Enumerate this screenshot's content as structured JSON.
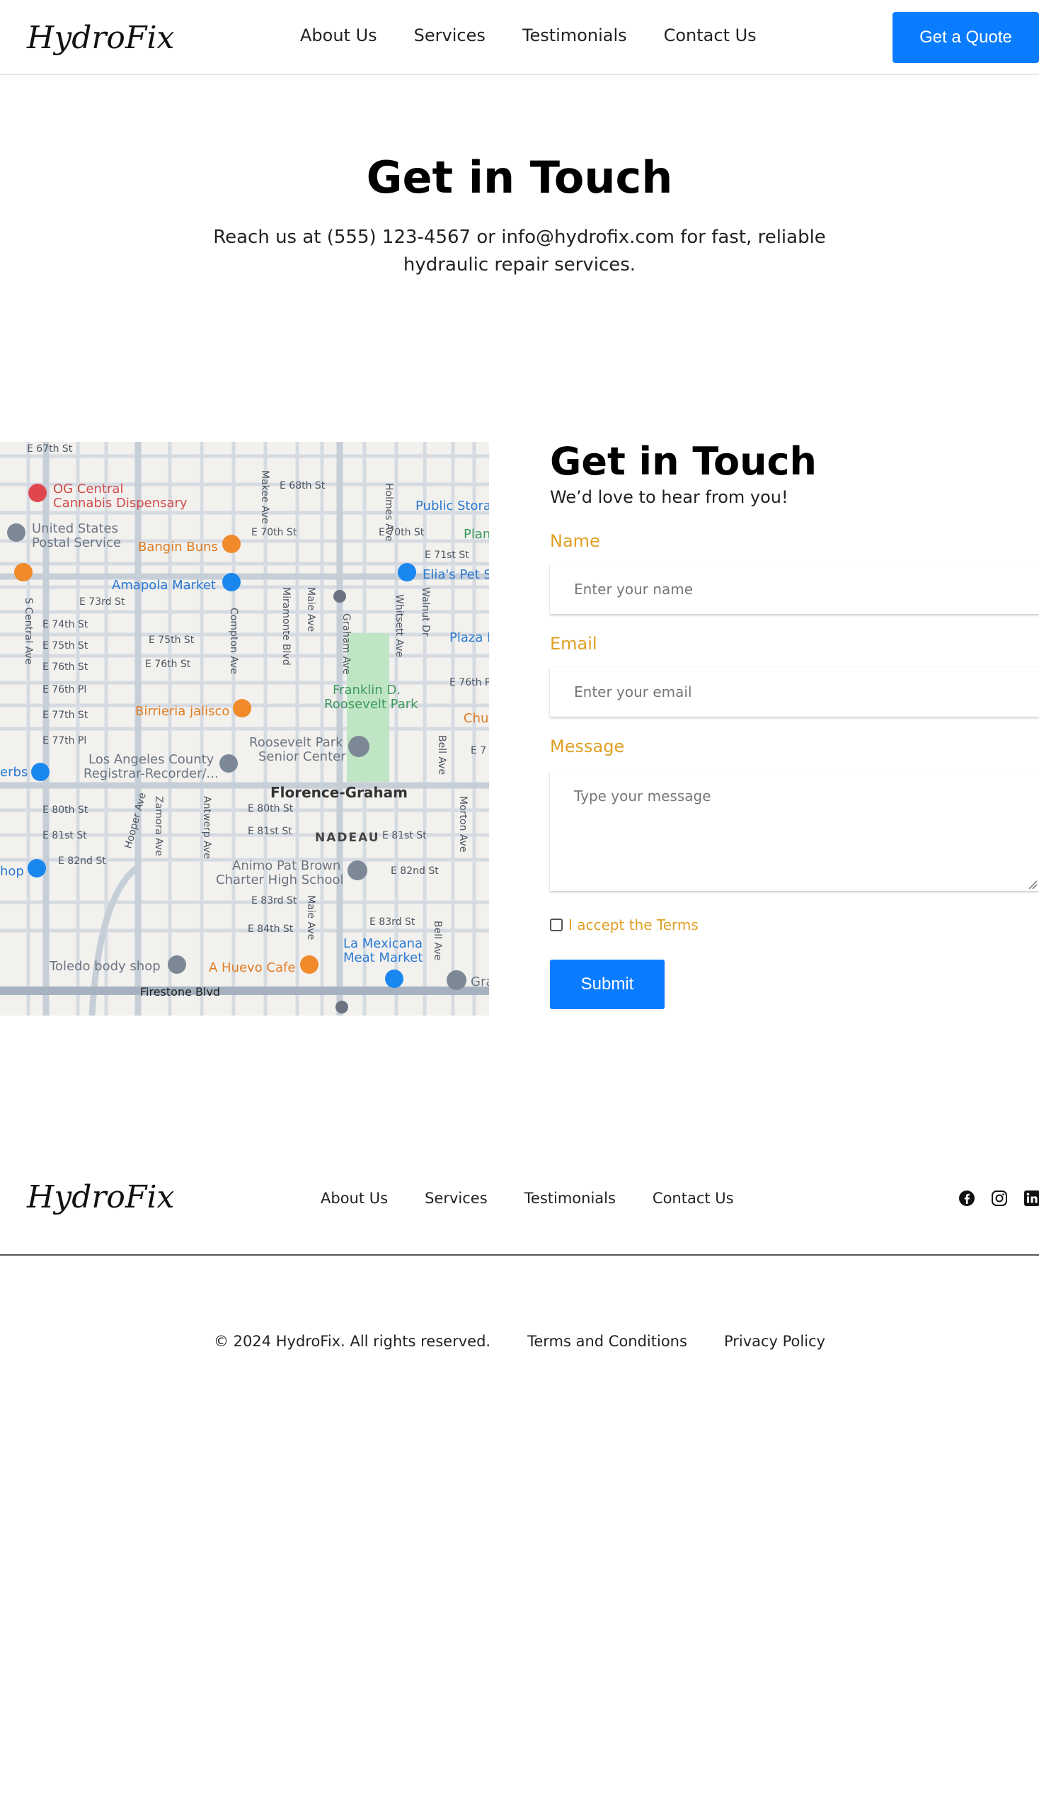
{
  "header": {
    "logo": "HydroFix",
    "nav": [
      "About Us",
      "Services",
      "Testimonials",
      "Contact Us"
    ],
    "cta": "Get a Quote"
  },
  "hero": {
    "title": "Get in Touch",
    "subtitle": "Reach us at (555) 123-4567 or info@hydrofix.com for fast, reliable hydraulic repair services."
  },
  "map": {
    "places": [
      "OG Central Cannabis Dispensary",
      "United States Postal Service",
      "Bangin Buns",
      "Amapola Market",
      "Elia's Pet S",
      "Birrieria jalisco",
      "Franklin D. Roosevelt Park",
      "Roosevelt Park Senior Center",
      "Los Angeles County Registrar-Recorder/...",
      "Florence-Graham",
      "NADEAU",
      "Animo Pat Brown Charter High School",
      "Toledo body shop",
      "A Huevo Cafe",
      "La Mexicana Meat Market",
      "Public Stora",
      "Plaza I",
      "Firestone Blvd"
    ],
    "streets": [
      "E 67th St",
      "E 68th St",
      "E 70th St",
      "E 71st St",
      "E 73rd St",
      "E 74th St",
      "E 75th St",
      "E 76th St",
      "E 76th Pl",
      "E 77th St",
      "E 77th Pl",
      "E 80th St",
      "E 81st St",
      "E 82nd St",
      "E 83rd St",
      "E 84th St",
      "S Central Ave",
      "Compton Ave",
      "Miramonte Blvd",
      "Maie Ave",
      "Graham Ave",
      "Whitsett Ave",
      "Walnut Dr",
      "Holmes Ave",
      "Makee Ave",
      "Hooper Ave",
      "Zamora Ave",
      "Antwerp Ave",
      "Bell Ave",
      "Morton Ave"
    ]
  },
  "form": {
    "title": "Get in Touch",
    "subtitle": "We’d love to hear from you!",
    "name_label": "Name",
    "name_placeholder": "Enter your name",
    "email_label": "Email",
    "email_placeholder": "Enter your email",
    "message_label": "Message",
    "message_placeholder": "Type your message",
    "terms": "I accept the Terms",
    "submit": "Submit"
  },
  "footer": {
    "logo": "HydroFix",
    "nav": [
      "About Us",
      "Services",
      "Testimonials",
      "Contact Us"
    ],
    "social": [
      "facebook-icon",
      "instagram-icon",
      "linkedin-icon"
    ],
    "copyright": "© 2024 HydroFix. All rights reserved.",
    "terms_link": "Terms and Conditions",
    "privacy_link": "Privacy Policy"
  },
  "colors": {
    "accent": "#0a7cff",
    "label": "#e0a024"
  }
}
